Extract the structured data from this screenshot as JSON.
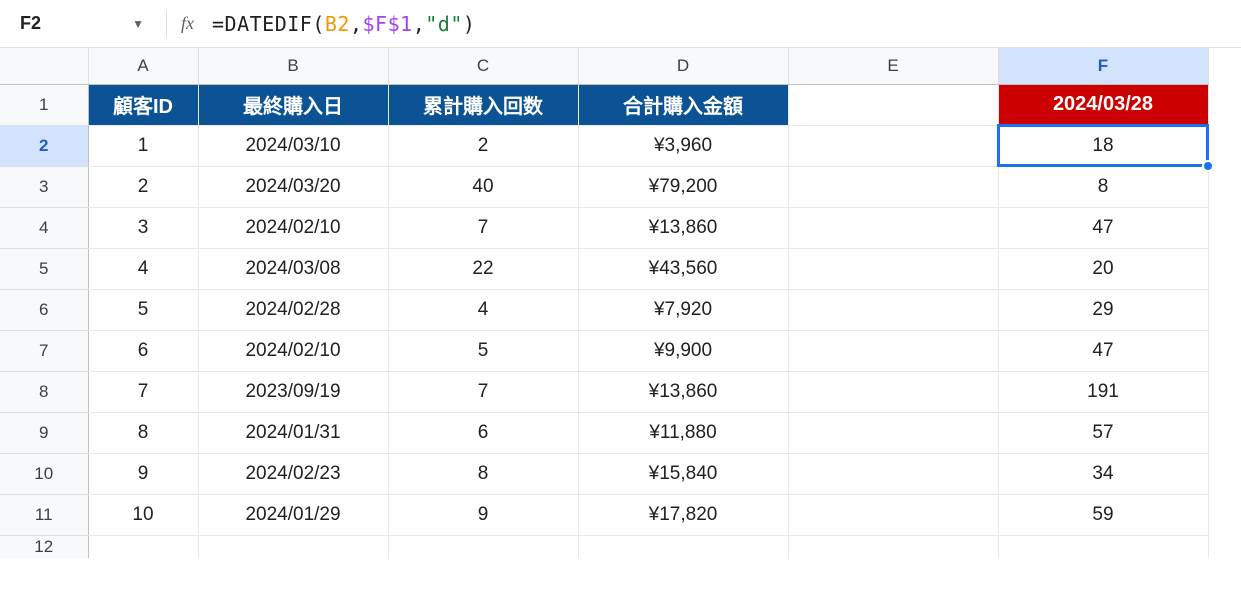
{
  "nameBox": "F2",
  "formula": {
    "prefix": "=DATEDIF(",
    "arg1": "B2",
    "comma": ",",
    "arg2": "$F$1",
    "arg3": "\"d\"",
    "suffix": ")"
  },
  "columns": [
    "A",
    "B",
    "C",
    "D",
    "E",
    "F"
  ],
  "activeCol": "F",
  "activeRow": 2,
  "headerRow": {
    "A": "顧客ID",
    "B": "最終購入日",
    "C": "累計購入回数",
    "D": "合計購入金額",
    "E": "",
    "F": "2024/03/28"
  },
  "rows": [
    {
      "n": 2,
      "A": "1",
      "B": "2024/03/10",
      "C": "2",
      "D": "¥3,960",
      "E": "",
      "F": "18"
    },
    {
      "n": 3,
      "A": "2",
      "B": "2024/03/20",
      "C": "40",
      "D": "¥79,200",
      "E": "",
      "F": "8"
    },
    {
      "n": 4,
      "A": "3",
      "B": "2024/02/10",
      "C": "7",
      "D": "¥13,860",
      "E": "",
      "F": "47"
    },
    {
      "n": 5,
      "A": "4",
      "B": "2024/03/08",
      "C": "22",
      "D": "¥43,560",
      "E": "",
      "F": "20"
    },
    {
      "n": 6,
      "A": "5",
      "B": "2024/02/28",
      "C": "4",
      "D": "¥7,920",
      "E": "",
      "F": "29"
    },
    {
      "n": 7,
      "A": "6",
      "B": "2024/02/10",
      "C": "5",
      "D": "¥9,900",
      "E": "",
      "F": "47"
    },
    {
      "n": 8,
      "A": "7",
      "B": "2023/09/19",
      "C": "7",
      "D": "¥13,860",
      "E": "",
      "F": "191"
    },
    {
      "n": 9,
      "A": "8",
      "B": "2024/01/31",
      "C": "6",
      "D": "¥11,880",
      "E": "",
      "F": "57"
    },
    {
      "n": 10,
      "A": "9",
      "B": "2024/02/23",
      "C": "8",
      "D": "¥15,840",
      "E": "",
      "F": "34"
    },
    {
      "n": 11,
      "A": "10",
      "B": "2024/01/29",
      "C": "9",
      "D": "¥17,820",
      "E": "",
      "F": "59"
    }
  ],
  "emptyRow": 12
}
